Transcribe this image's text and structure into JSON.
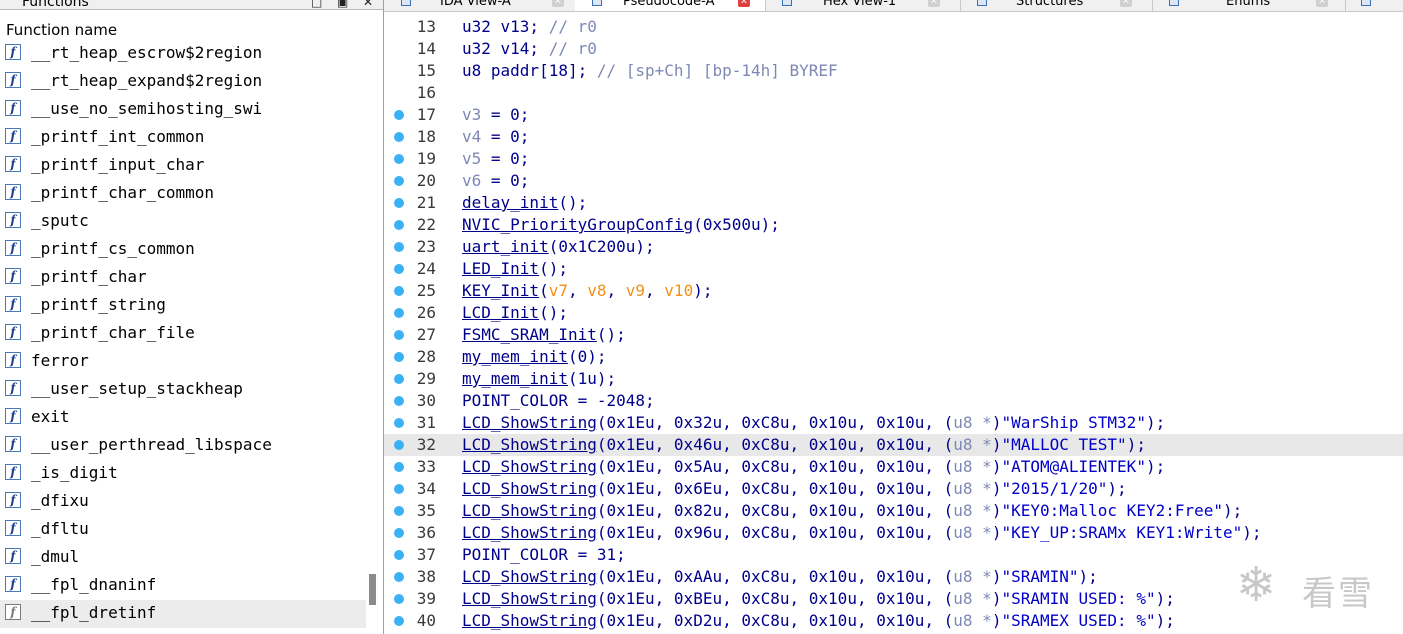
{
  "functions_panel": {
    "title": "Functions",
    "column_header": "Function name",
    "items": [
      {
        "name": "__rt_heap_escrow$2region"
      },
      {
        "name": "__rt_heap_expand$2region"
      },
      {
        "name": "__use_no_semihosting_swi"
      },
      {
        "name": "_printf_int_common"
      },
      {
        "name": "_printf_input_char"
      },
      {
        "name": "_printf_char_common"
      },
      {
        "name": "_sputc"
      },
      {
        "name": "_printf_cs_common"
      },
      {
        "name": "_printf_char"
      },
      {
        "name": "_printf_string"
      },
      {
        "name": "_printf_char_file"
      },
      {
        "name": "ferror"
      },
      {
        "name": "__user_setup_stackheap"
      },
      {
        "name": "exit"
      },
      {
        "name": "__user_perthread_libspace"
      },
      {
        "name": "_is_digit"
      },
      {
        "name": "_dfixu"
      },
      {
        "name": "_dfltu"
      },
      {
        "name": "_dmul"
      },
      {
        "name": "__fpl_dnaninf"
      },
      {
        "name": "__fpl_dretinf",
        "selected": true
      }
    ]
  },
  "tabs": [
    {
      "label": "IDA View-A",
      "icon": "ida-view-icon"
    },
    {
      "label": "Pseudocode-A",
      "icon": "pseudocode-icon",
      "active": true
    },
    {
      "label": "Hex View-1",
      "icon": "hex-view-icon"
    },
    {
      "label": "Structures",
      "icon": "structures-icon"
    },
    {
      "label": "Enums",
      "icon": "enums-icon"
    }
  ],
  "code": {
    "current_line": 32,
    "lines": [
      {
        "no": "13",
        "bp": false,
        "tokens": [
          [
            "t",
            "u32 v13; "
          ],
          [
            "cmt",
            "// "
          ],
          [
            "gray",
            "r0"
          ]
        ]
      },
      {
        "no": "14",
        "bp": false,
        "tokens": [
          [
            "t",
            "u32 v14; "
          ],
          [
            "cmt",
            "// "
          ],
          [
            "gray",
            "r0"
          ]
        ]
      },
      {
        "no": "15",
        "bp": false,
        "tokens": [
          [
            "t",
            "u8 paddr[18]; "
          ],
          [
            "cmt",
            "// "
          ],
          [
            "gray",
            "[sp+Ch] [bp-14h]"
          ],
          [
            "cmt",
            " BYREF"
          ]
        ]
      },
      {
        "no": "16",
        "bp": false,
        "tokens": []
      },
      {
        "no": "17",
        "bp": true,
        "tokens": [
          [
            "gray",
            "v3"
          ],
          [
            "t",
            " = 0;"
          ]
        ]
      },
      {
        "no": "18",
        "bp": true,
        "tokens": [
          [
            "gray",
            "v4"
          ],
          [
            "t",
            " = 0;"
          ]
        ]
      },
      {
        "no": "19",
        "bp": true,
        "tokens": [
          [
            "gray",
            "v5"
          ],
          [
            "t",
            " = 0;"
          ]
        ]
      },
      {
        "no": "20",
        "bp": true,
        "tokens": [
          [
            "gray",
            "v6"
          ],
          [
            "t",
            " = 0;"
          ]
        ]
      },
      {
        "no": "21",
        "bp": true,
        "tokens": [
          [
            "fn",
            "delay_init"
          ],
          [
            "t",
            "();"
          ]
        ]
      },
      {
        "no": "22",
        "bp": true,
        "tokens": [
          [
            "fn",
            "NVIC_PriorityGroupConfig"
          ],
          [
            "t",
            "(0x500u);"
          ]
        ]
      },
      {
        "no": "23",
        "bp": true,
        "tokens": [
          [
            "fn",
            "uart_init"
          ],
          [
            "t",
            "(0x1C200u);"
          ]
        ]
      },
      {
        "no": "24",
        "bp": true,
        "tokens": [
          [
            "fn",
            "LED_Init"
          ],
          [
            "t",
            "();"
          ]
        ]
      },
      {
        "no": "25",
        "bp": true,
        "tokens": [
          [
            "fn",
            "KEY_Init"
          ],
          [
            "t",
            "("
          ],
          [
            "org",
            "v7"
          ],
          [
            "t",
            ", "
          ],
          [
            "org",
            "v8"
          ],
          [
            "t",
            ", "
          ],
          [
            "org",
            "v9"
          ],
          [
            "t",
            ", "
          ],
          [
            "org",
            "v10"
          ],
          [
            "t",
            ");"
          ]
        ]
      },
      {
        "no": "26",
        "bp": true,
        "tokens": [
          [
            "fn",
            "LCD_Init"
          ],
          [
            "t",
            "();"
          ]
        ]
      },
      {
        "no": "27",
        "bp": true,
        "tokens": [
          [
            "fn",
            "FSMC_SRAM_Init"
          ],
          [
            "t",
            "();"
          ]
        ]
      },
      {
        "no": "28",
        "bp": true,
        "tokens": [
          [
            "fn",
            "my_mem_init"
          ],
          [
            "t",
            "(0);"
          ]
        ]
      },
      {
        "no": "29",
        "bp": true,
        "tokens": [
          [
            "fn",
            "my_mem_init"
          ],
          [
            "t",
            "(1u);"
          ]
        ]
      },
      {
        "no": "30",
        "bp": true,
        "tokens": [
          [
            "t",
            "POINT_COLOR = -2048;"
          ]
        ]
      },
      {
        "no": "31",
        "bp": true,
        "tokens": [
          [
            "fn",
            "LCD_ShowString"
          ],
          [
            "t",
            "(0x1Eu, 0x32u, 0xC8u, 0x10u, 0x10u, ("
          ],
          [
            "gray",
            "u8 *"
          ],
          [
            "t",
            ")"
          ],
          [
            "str",
            "\"WarShip STM32\""
          ],
          [
            "t",
            ");"
          ]
        ]
      },
      {
        "no": "32",
        "bp": true,
        "tokens": [
          [
            "fn",
            "LCD_ShowString"
          ],
          [
            "t",
            "(0x1Eu, 0x46u, 0xC8u, 0x10u, 0x10u, ("
          ],
          [
            "gray",
            "u8 *"
          ],
          [
            "t",
            ")"
          ],
          [
            "str",
            "\"MALLOC TEST\""
          ],
          [
            "t",
            ");"
          ]
        ]
      },
      {
        "no": "33",
        "bp": true,
        "tokens": [
          [
            "fn",
            "LCD_ShowString"
          ],
          [
            "t",
            "(0x1Eu, 0x5Au, 0xC8u, 0x10u, 0x10u, ("
          ],
          [
            "gray",
            "u8 *"
          ],
          [
            "t",
            ")"
          ],
          [
            "str",
            "\"ATOM@ALIENTEK\""
          ],
          [
            "t",
            ");"
          ]
        ]
      },
      {
        "no": "34",
        "bp": true,
        "tokens": [
          [
            "fn",
            "LCD_ShowString"
          ],
          [
            "t",
            "(0x1Eu, 0x6Eu, 0xC8u, 0x10u, 0x10u, ("
          ],
          [
            "gray",
            "u8 *"
          ],
          [
            "t",
            ")"
          ],
          [
            "str",
            "\"2015/1/20\""
          ],
          [
            "t",
            ");"
          ]
        ]
      },
      {
        "no": "35",
        "bp": true,
        "tokens": [
          [
            "fn",
            "LCD_ShowString"
          ],
          [
            "t",
            "(0x1Eu, 0x82u, 0xC8u, 0x10u, 0x10u, ("
          ],
          [
            "gray",
            "u8 *"
          ],
          [
            "t",
            ")"
          ],
          [
            "str",
            "\"KEY0:Malloc  KEY2:Free\""
          ],
          [
            "t",
            ");"
          ]
        ]
      },
      {
        "no": "36",
        "bp": true,
        "tokens": [
          [
            "fn",
            "LCD_ShowString"
          ],
          [
            "t",
            "(0x1Eu, 0x96u, 0xC8u, 0x10u, 0x10u, ("
          ],
          [
            "gray",
            "u8 *"
          ],
          [
            "t",
            ")"
          ],
          [
            "str",
            "\"KEY_UP:SRAMx KEY1:Write\""
          ],
          [
            "t",
            ");"
          ]
        ]
      },
      {
        "no": "37",
        "bp": true,
        "tokens": [
          [
            "t",
            "POINT_COLOR = 31;"
          ]
        ]
      },
      {
        "no": "38",
        "bp": true,
        "tokens": [
          [
            "fn",
            "LCD_ShowString"
          ],
          [
            "t",
            "(0x1Eu, 0xAAu, 0xC8u, 0x10u, 0x10u, ("
          ],
          [
            "gray",
            "u8 *"
          ],
          [
            "t",
            ")"
          ],
          [
            "str",
            "\"SRAMIN\""
          ],
          [
            "t",
            ");"
          ]
        ]
      },
      {
        "no": "39",
        "bp": true,
        "tokens": [
          [
            "fn",
            "LCD_ShowString"
          ],
          [
            "t",
            "(0x1Eu, 0xBEu, 0xC8u, 0x10u, 0x10u, ("
          ],
          [
            "gray",
            "u8 *"
          ],
          [
            "t",
            ")"
          ],
          [
            "str",
            "\"SRAMIN USED:   %\""
          ],
          [
            "t",
            ");"
          ]
        ]
      },
      {
        "no": "40",
        "bp": true,
        "tokens": [
          [
            "fn",
            "LCD_ShowString"
          ],
          [
            "t",
            "(0x1Eu, 0xD2u, 0xC8u, 0x10u, 0x10u, ("
          ],
          [
            "gray",
            "u8 *"
          ],
          [
            "t",
            ")"
          ],
          [
            "str",
            "\"SRAMEX USED:   %\""
          ],
          [
            "t",
            ");"
          ]
        ]
      }
    ]
  },
  "watermark": {
    "icon": "snowflake-icon",
    "text": "看雪"
  }
}
